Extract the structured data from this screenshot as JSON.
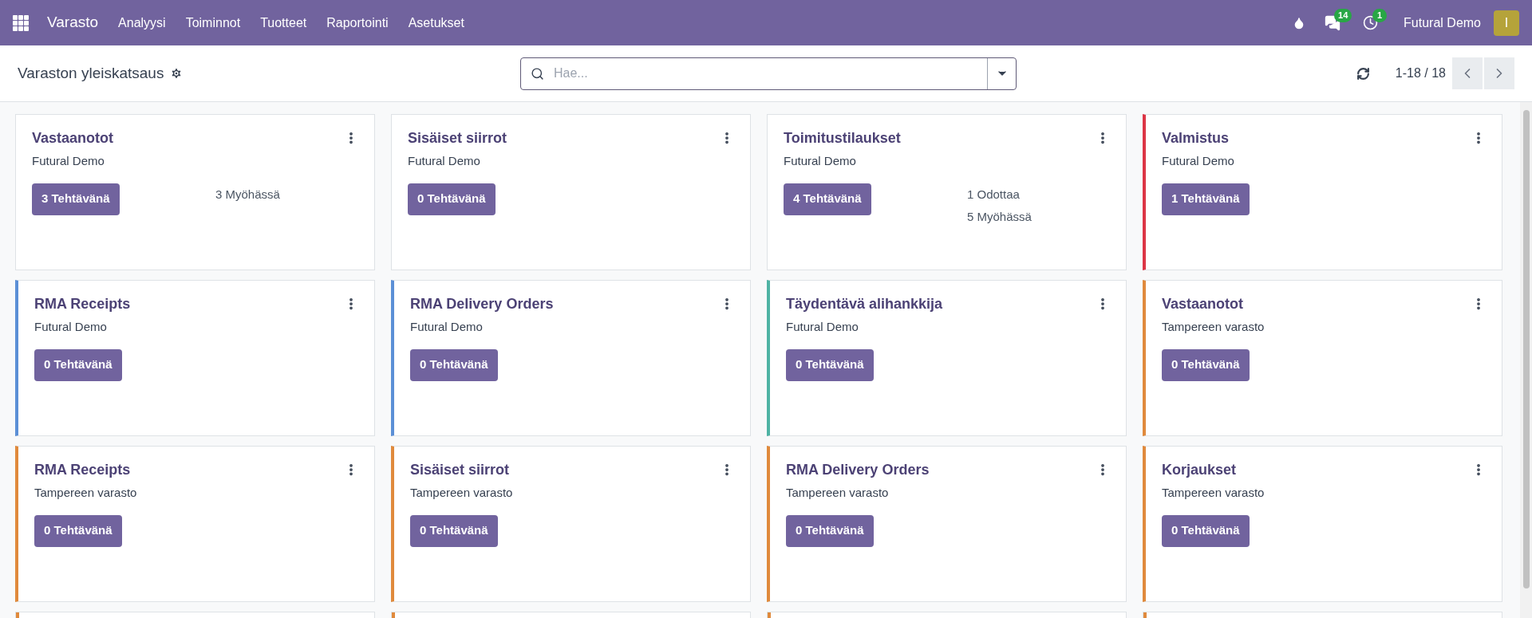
{
  "navbar": {
    "app": "Varasto",
    "menus": [
      "Analyysi",
      "Toiminnot",
      "Tuotteet",
      "Raportointi",
      "Asetukset"
    ],
    "messages_count": "14",
    "activities_count": "1",
    "company": "Futural Demo",
    "avatar": "I"
  },
  "control_panel": {
    "title": "Varaston yleiskatsaus",
    "search": {
      "placeholder": "Hae..."
    },
    "pager": "1-18 / 18"
  },
  "cards": [
    {
      "title": "Vastaanotot",
      "subtitle": "Futural Demo",
      "button": "3 Tehtävänä",
      "stats": [
        "3 Myöhässä"
      ]
    },
    {
      "title": "Sisäiset siirrot",
      "subtitle": "Futural Demo",
      "button": "0 Tehtävänä"
    },
    {
      "title": "Toimitustilaukset",
      "subtitle": "Futural Demo",
      "button": "4 Tehtävänä",
      "stats": [
        "1 Odottaa",
        "5 Myöhässä"
      ]
    },
    {
      "title": "Valmistus",
      "subtitle": "Futural Demo",
      "button": "1 Tehtävänä",
      "color": "#dc3545"
    },
    {
      "title": "RMA Receipts",
      "subtitle": "Futural Demo",
      "button": "0 Tehtävänä",
      "color": "#5b8fd6"
    },
    {
      "title": "RMA Delivery Orders",
      "subtitle": "Futural Demo",
      "button": "0 Tehtävänä",
      "color": "#5b8fd6"
    },
    {
      "title": "Täydentävä alihankkija",
      "subtitle": "Futural Demo",
      "button": "0 Tehtävänä",
      "color": "#4fb3a4"
    },
    {
      "title": "Vastaanotot",
      "subtitle": "Tampereen varasto",
      "button": "0 Tehtävänä",
      "color": "#e08a3c"
    },
    {
      "title": "RMA Receipts",
      "subtitle": "Tampereen varasto",
      "button": "0 Tehtävänä",
      "color": "#e08a3c"
    },
    {
      "title": "Sisäiset siirrot",
      "subtitle": "Tampereen varasto",
      "button": "0 Tehtävänä",
      "color": "#e08a3c"
    },
    {
      "title": "RMA Delivery Orders",
      "subtitle": "Tampereen varasto",
      "button": "0 Tehtävänä",
      "color": "#e08a3c"
    },
    {
      "title": "Korjaukset",
      "subtitle": "Tampereen varasto",
      "button": "0 Tehtävänä",
      "color": "#e08a3c"
    }
  ],
  "partial_cards": [
    {
      "color": "#e08a3c"
    },
    {
      "color": "#e08a3c"
    },
    {
      "color": "#e08a3c"
    },
    {
      "color": "#e08a3c"
    }
  ]
}
